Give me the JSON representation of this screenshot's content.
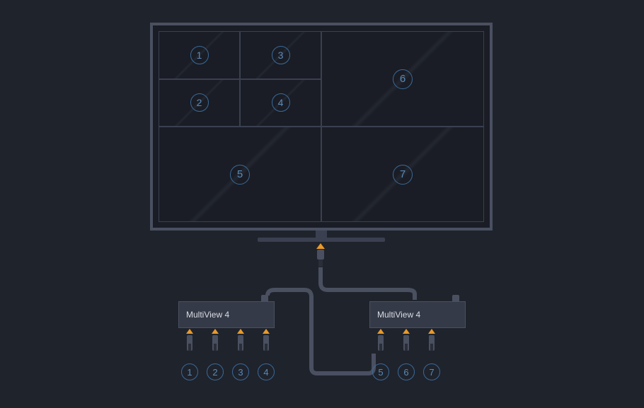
{
  "monitor": {
    "tiles": [
      "1",
      "2",
      "3",
      "4",
      "5",
      "6",
      "7"
    ]
  },
  "devices": {
    "left": {
      "label": "MultiView 4",
      "inputs": [
        "1",
        "2",
        "3",
        "4"
      ]
    },
    "right": {
      "label": "MultiView 4",
      "inputs": [
        "5",
        "6",
        "7"
      ]
    }
  }
}
